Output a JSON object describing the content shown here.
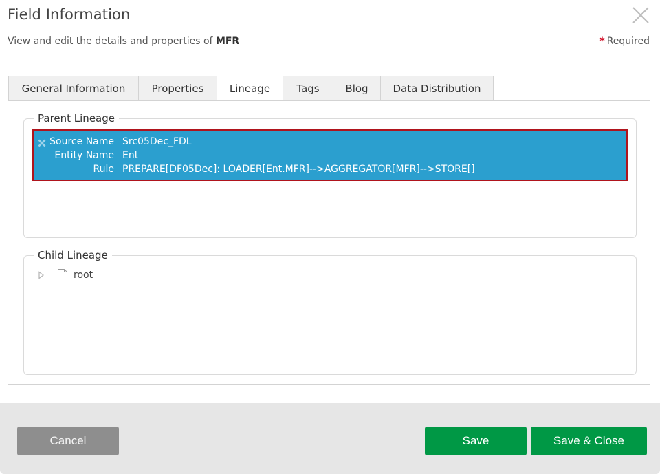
{
  "dialog": {
    "title": "Field Information",
    "subtitle_prefix": "View and edit the details and properties of",
    "subtitle_entity": "MFR",
    "required_marker": "*",
    "required_label": "Required",
    "close_icon": "close-icon"
  },
  "tabs": [
    {
      "label": "General Information",
      "active": false
    },
    {
      "label": "Properties",
      "active": false
    },
    {
      "label": "Lineage",
      "active": true
    },
    {
      "label": "Tags",
      "active": false
    },
    {
      "label": "Blog",
      "active": false
    },
    {
      "label": "Data Distribution",
      "active": false
    }
  ],
  "lineage": {
    "parent": {
      "legend": "Parent Lineage",
      "items": [
        {
          "remove_icon": "remove-x-icon",
          "fields": [
            {
              "key": "Source Name",
              "value": "Src05Dec_FDL"
            },
            {
              "key": "Entity Name",
              "value": "Ent"
            },
            {
              "key": "Rule",
              "value": "PREPARE[DF05Dec]: LOADER[Ent.MFR]-->AGGREGATOR[MFR]-->STORE[]"
            }
          ]
        }
      ]
    },
    "child": {
      "legend": "Child Lineage",
      "tree": [
        {
          "label": "root",
          "expanded": false,
          "icon": "file-icon"
        }
      ]
    }
  },
  "footer": {
    "cancel_label": "Cancel",
    "save_label": "Save",
    "save_close_label": "Save & Close"
  },
  "colors": {
    "selected_item_bg": "#2b9fcf",
    "selected_item_border": "#b0141d",
    "primary_button": "#009845",
    "cancel_button": "#8e8e8e",
    "required_star": "#d0021b"
  }
}
